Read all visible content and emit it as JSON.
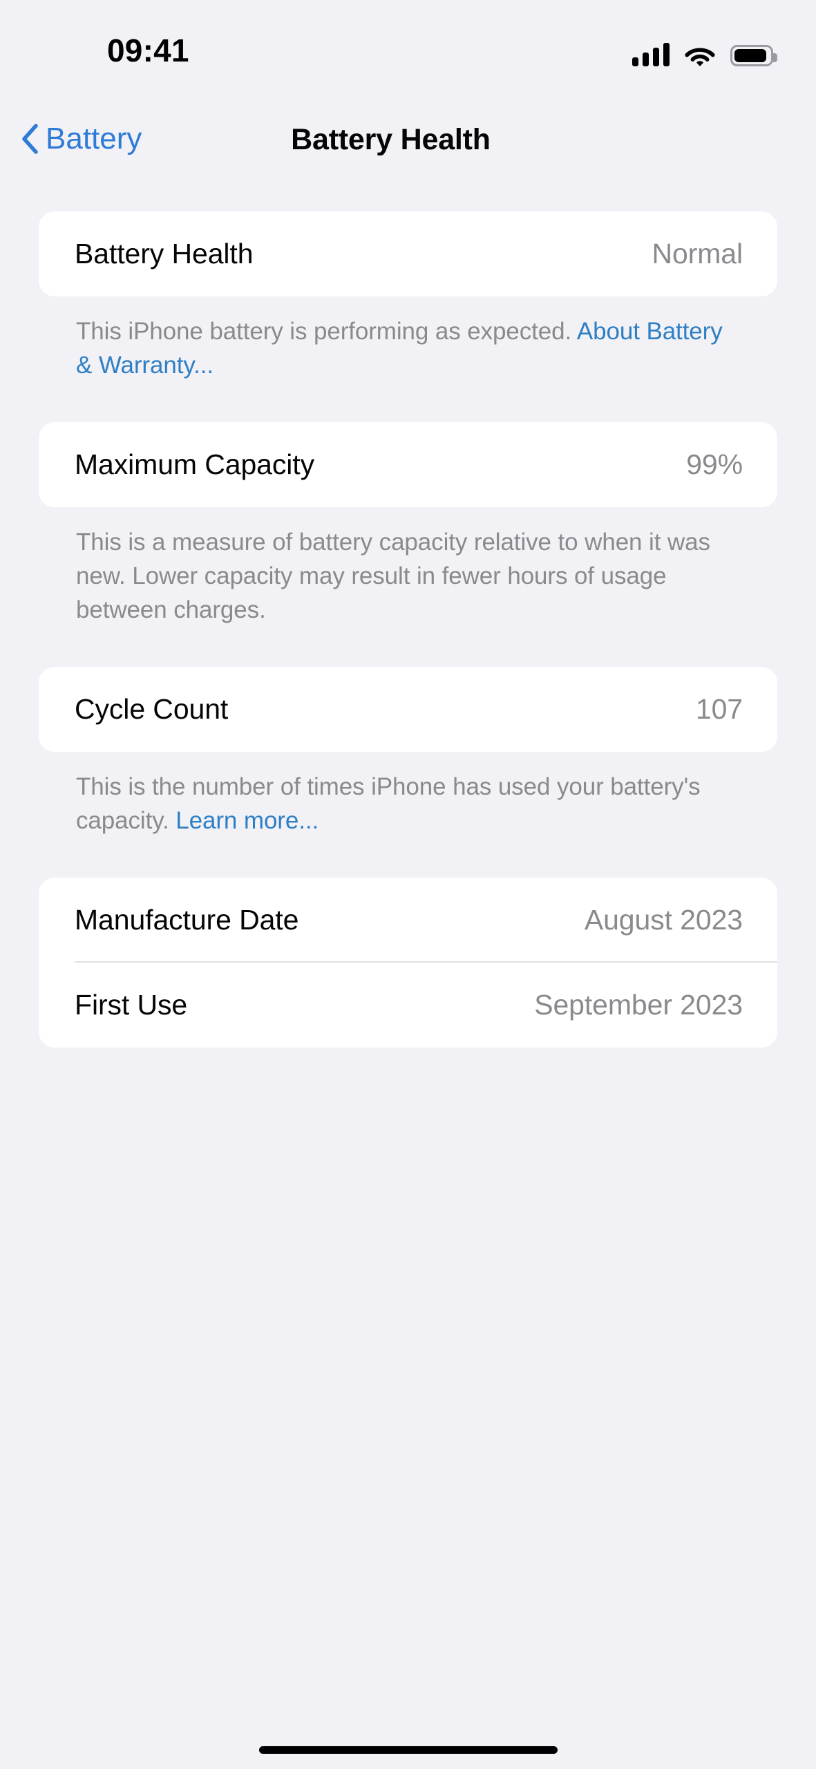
{
  "status_bar": {
    "time": "09:41",
    "cellular_icon": "cellular-signal-icon",
    "cellular_bars": 4,
    "wifi_icon": "wifi-icon",
    "battery_icon": "battery-icon"
  },
  "nav": {
    "back_icon": "chevron-left-icon",
    "back_label": "Battery",
    "title": "Battery Health"
  },
  "sections": [
    {
      "rows": [
        {
          "label": "Battery Health",
          "value": "Normal"
        }
      ],
      "footer_text": "This iPhone battery is performing as expected. ",
      "footer_link": "About Battery & Warranty..."
    },
    {
      "rows": [
        {
          "label": "Maximum Capacity",
          "value": "99%"
        }
      ],
      "footer_text": "This is a measure of battery capacity relative to when it was new. Lower capacity may result in fewer hours of usage between charges.",
      "footer_link": ""
    },
    {
      "rows": [
        {
          "label": "Cycle Count",
          "value": "107"
        }
      ],
      "footer_text": "This is the number of times iPhone has used your battery's capacity. ",
      "footer_link": "Learn more..."
    },
    {
      "rows": [
        {
          "label": "Manufacture Date",
          "value": "August 2023"
        },
        {
          "label": "First Use",
          "value": "September 2023"
        }
      ],
      "footer_text": "",
      "footer_link": ""
    }
  ],
  "home_indicator": "home-indicator",
  "colors": {
    "background": "#F1F1F6",
    "card": "#FFFFFF",
    "label": "#050505",
    "value": "#8A8A8E",
    "link": "#2F7FC4",
    "nav_tint": "#2E7CD6",
    "separator": "#E0E0E3"
  }
}
